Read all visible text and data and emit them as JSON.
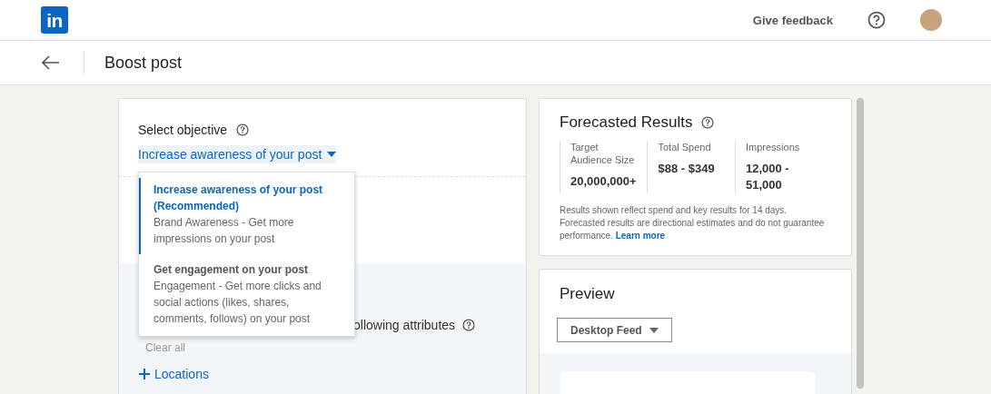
{
  "topbar": {
    "logo": "in",
    "feedback": "Give feedback"
  },
  "header": {
    "title": "Boost post"
  },
  "objective": {
    "label": "Select objective",
    "value": "Increase awareness of your post",
    "expanded": true,
    "options": [
      {
        "title": "Increase awareness of your post (Recommended)",
        "description": "Brand Awareness - Get more impressions on your post",
        "selected": true
      },
      {
        "title": "Get engagement on your post",
        "description": "Engagement - Get more clicks and social actions (likes, shares, comments, follows) on your post",
        "selected": false
      }
    ]
  },
  "audience": {
    "heading": "ollowing attributes",
    "clear": "Clear all",
    "clear_disabled": true,
    "add": "Locations"
  },
  "forecast": {
    "title": "Forecasted Results",
    "metrics": [
      {
        "label": "Target Audience Size",
        "value": "20,000,000+"
      },
      {
        "label": "Total Spend",
        "value": "$88 - $349"
      },
      {
        "label": "Impressions",
        "value": "12,000 - 51,000"
      }
    ],
    "note": "Results shown reflect spend and key results for 14 days. Forecasted results are directional estimates and do not guarantee performance.",
    "link": "Learn more"
  },
  "preview": {
    "title": "Preview",
    "view": "Desktop Feed"
  }
}
